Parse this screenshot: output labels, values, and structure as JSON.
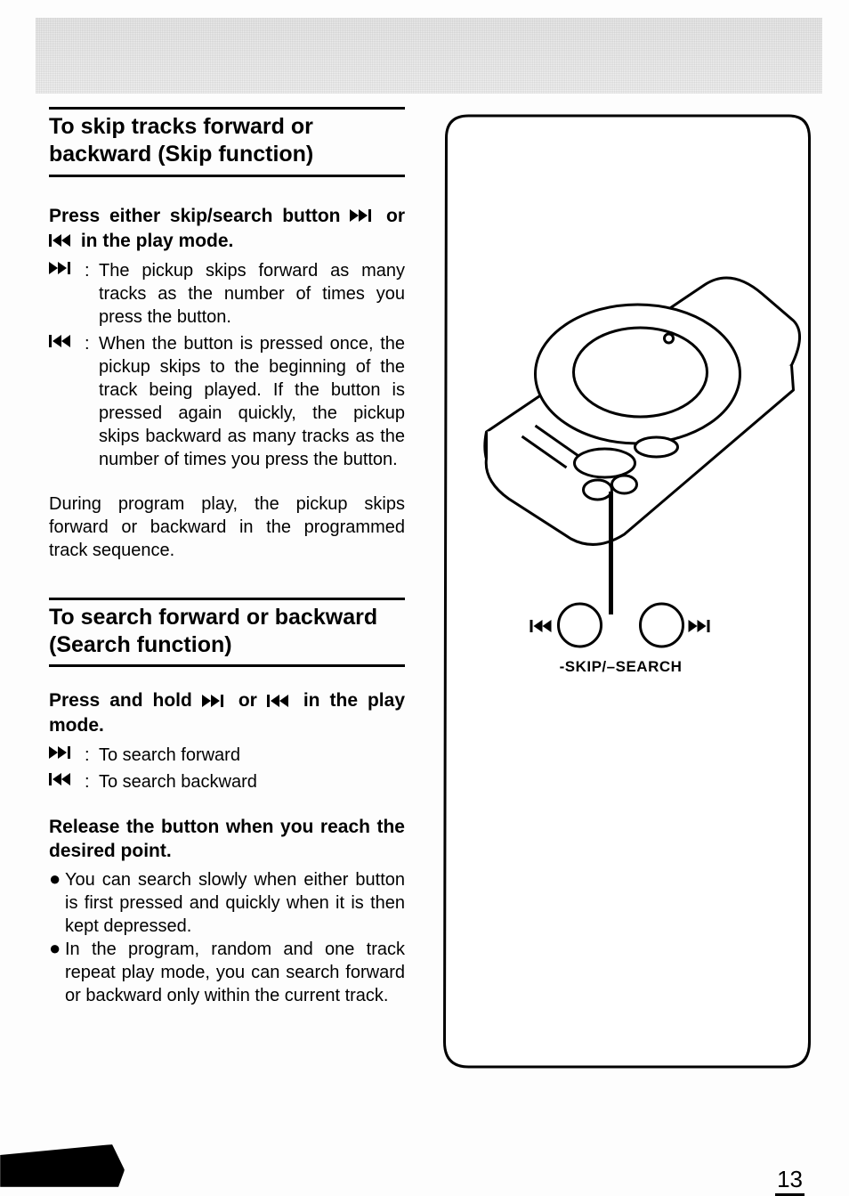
{
  "page_number": "13",
  "figure": {
    "callout_label": "-SKIP/–SEARCH",
    "buttons": {
      "prev": "⏮",
      "next": "⏭"
    }
  },
  "skip_section": {
    "heading": "To skip tracks forward or backward (Skip function)",
    "lead_pre": "Press either skip/search button ",
    "lead_mid": " or ",
    "lead_post": " in the play mode.",
    "fwd_desc": "The pickup skips forward as many tracks as the number of times you press the button.",
    "back_desc": "When the button is pressed once, the pickup skips to the beginning of the track being played. If the button is pressed again quickly, the pickup skips backward as many tracks as the number of times you press the button.",
    "note": "During program play, the pickup skips forward or backward in the programmed track sequence."
  },
  "search_section": {
    "heading": "To search forward or backward (Search function)",
    "lead_pre": "Press and hold ",
    "lead_mid": " or ",
    "lead_post": " in the play mode.",
    "fwd_desc": "To search forward",
    "back_desc": "To search backward",
    "release": "Release the button when you reach the desired point.",
    "bullet1": "You can search slowly when either button is first pressed and quickly when it is then kept depressed.",
    "bullet2": "In the program, random and one track repeat play mode, you can search forward or backward only within the current track."
  }
}
